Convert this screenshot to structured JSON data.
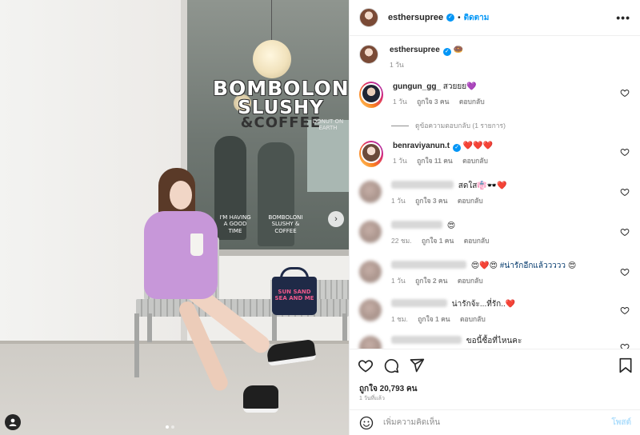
{
  "post_header": {
    "username": "esthersupree",
    "separator": "•",
    "follow_label": "ติดตาม",
    "more_icon": "more-horizontal-icon"
  },
  "photo": {
    "sign_line1": "BOMBOLONI",
    "sign_line2": "SLUSHY",
    "sign_line3": "&COFFEE",
    "window_text1": "I'M HAVING A GOOD TIME",
    "window_text2": "BOMBOLONI SLUSHY & COFFEE",
    "window_text3": "DONUT ON EARTH",
    "bag_text": "SUN SAND SEA AND ME",
    "carousel_total": 2,
    "carousel_active": 1
  },
  "caption": {
    "username": "esthersupree",
    "text": "🍩",
    "time": "1 วัน"
  },
  "comments": [
    {
      "username": "gungun_gg_",
      "verified": false,
      "text": "สวยยย💜",
      "time": "1 วัน",
      "likes": "ถูกใจ 3 คน",
      "reply": "ตอบกลับ",
      "blurred": false
    },
    {
      "username": "benraviyanun.t",
      "verified": true,
      "text": "❤️❤️❤️",
      "time": "1 วัน",
      "likes": "ถูกใจ 11 คน",
      "reply": "ตอบกลับ",
      "blurred": false
    },
    {
      "username": "",
      "verified": false,
      "text": "สดใส👘🕶️❤️",
      "time": "1 วัน",
      "likes": "ถูกใจ 3 คน",
      "reply": "ตอบกลับ",
      "blurred": true
    },
    {
      "username": "",
      "verified": false,
      "text": "😍",
      "time": "22 ชม.",
      "likes": "ถูกใจ 1 คน",
      "reply": "ตอบกลับ",
      "blurred": true
    },
    {
      "username": "",
      "verified": false,
      "text": "😍❤️😍",
      "tag": "#น่ารักอีกแล้ววววว",
      "trail": "😍",
      "time": "1 วัน",
      "likes": "ถูกใจ 2 คน",
      "reply": "ตอบกลับ",
      "blurred": true
    },
    {
      "username": "",
      "verified": false,
      "text": "น่ารักจ้ะ...ที่รัก..❤️",
      "time": "1 ชม.",
      "likes": "ถูกใจ 1 คน",
      "reply": "ตอบกลับ",
      "blurred": true
    },
    {
      "username": "",
      "verified": false,
      "text": "ขอนี้ซื้อที่ไหนคะ",
      "time": "",
      "likes": "",
      "reply": "",
      "blurred": true
    }
  ],
  "hidden_replies_label": "ดูข้อความตอบกลับ (1 รายการ)",
  "actions": {
    "like_icon": "heart-icon",
    "comment_icon": "comment-icon",
    "share_icon": "send-icon",
    "save_icon": "bookmark-icon",
    "likes_text": "ถูกใจ 20,793 คน",
    "posted_text": "1 วันที่แล้ว"
  },
  "add_comment": {
    "emoji_icon": "smiley-icon",
    "placeholder": "เพิ่มความคิดเห็น",
    "post_label": "โพสต์"
  },
  "colors": {
    "accent": "#0095f6",
    "muted": "#8e8e8e",
    "post_disabled": "#b2dffc",
    "hashtag": "#00376b"
  }
}
